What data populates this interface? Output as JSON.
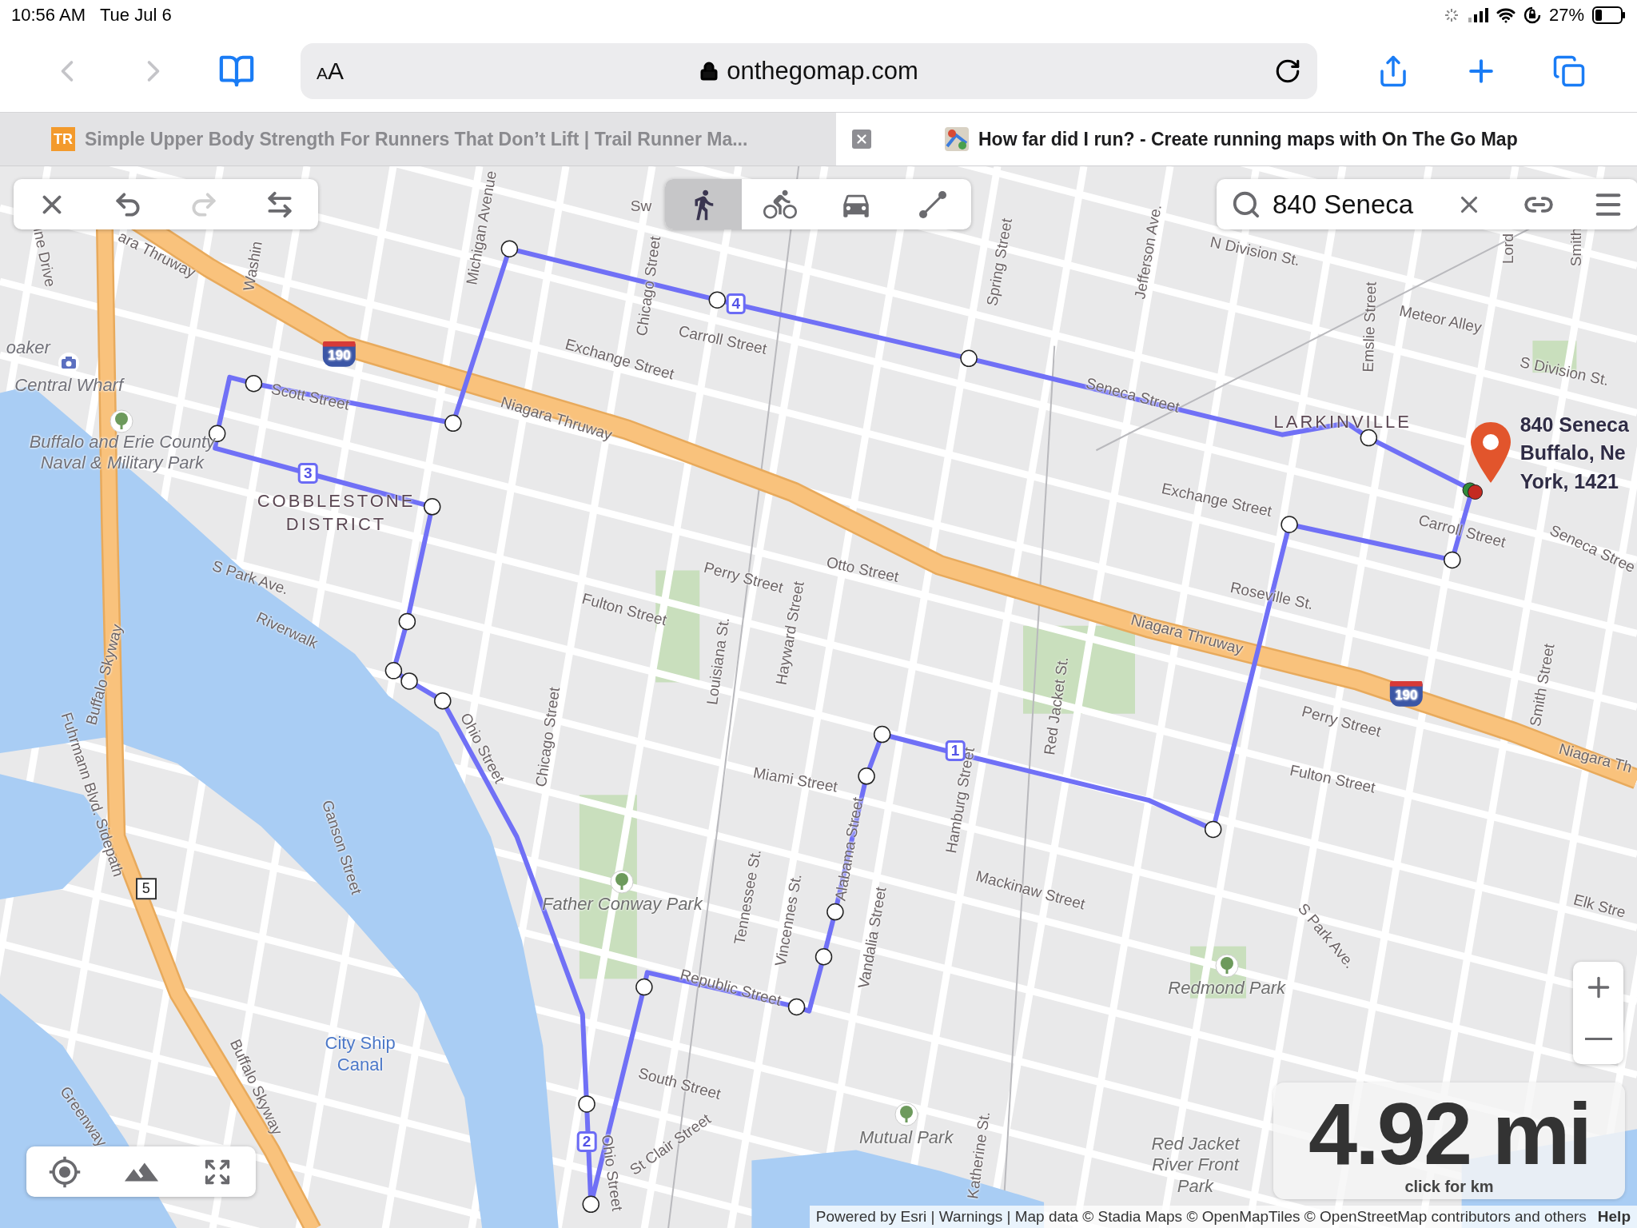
{
  "status_bar": {
    "time": "10:56 AM",
    "date": "Tue Jul 6",
    "battery": "27%"
  },
  "toolbar": {
    "nav": [
      {
        "kind": "back",
        "disabled": true
      },
      {
        "kind": "forward",
        "disabled": true
      }
    ],
    "text_size": "AA",
    "url": "onthegomap.com"
  },
  "tabs": [
    {
      "favicon": "TR",
      "title": "Simple Upper Body Strength For Runners That Don’t Lift | Trail Runner Ma...",
      "selected": false
    },
    {
      "title": "How far did I run? - Create running maps with On The Go Map",
      "selected": true
    }
  ],
  "map": {
    "edit_tools": [
      {
        "kind": "clear",
        "disabled": false
      },
      {
        "kind": "undo",
        "disabled": false
      },
      {
        "kind": "redo",
        "disabled": true
      },
      {
        "kind": "reverse",
        "disabled": false
      }
    ],
    "modes": [
      {
        "kind": "walk",
        "selected": true
      },
      {
        "kind": "bike",
        "selected": false
      },
      {
        "kind": "car",
        "selected": false
      },
      {
        "kind": "line",
        "selected": false
      }
    ],
    "search": {
      "value": "840 Seneca"
    },
    "labels": [
      {
        "kind": "street",
        "text": "ara Thruway"
      },
      {
        "kind": "street",
        "text": "ine Drive"
      },
      {
        "kind": "street",
        "text": "Washin"
      },
      {
        "kind": "street",
        "text": "Michigan Avenue"
      },
      {
        "kind": "street",
        "text": "Sw"
      },
      {
        "kind": "street",
        "text": "Chicago Street"
      },
      {
        "kind": "street",
        "text": "Carroll Street"
      },
      {
        "kind": "street",
        "text": "Exchange Street"
      },
      {
        "kind": "street",
        "text": "Scott Street"
      },
      {
        "kind": "street",
        "text": "Niagara Thruway"
      },
      {
        "kind": "poi",
        "text": "oaker"
      },
      {
        "kind": "poi",
        "text": "Central Wharf"
      },
      {
        "kind": "poi",
        "text": "Buffalo and Erie County Naval & Military Park"
      },
      {
        "kind": "district",
        "text": "COBBLESTONE DISTRICT"
      },
      {
        "kind": "street",
        "text": "S Park Ave."
      },
      {
        "kind": "street",
        "text": "Riverwalk"
      },
      {
        "kind": "street",
        "text": "Buffalo Skyway"
      },
      {
        "kind": "street",
        "text": "Fuhrmann Blvd. Sidepath"
      },
      {
        "kind": "street",
        "text": "Ohio Street"
      },
      {
        "kind": "street",
        "text": "Chicago Street"
      },
      {
        "kind": "street",
        "text": "Ganson Street"
      },
      {
        "kind": "street",
        "text": "Louisiana St."
      },
      {
        "kind": "street",
        "text": "Hayward Street"
      },
      {
        "kind": "street",
        "text": "Perry Street"
      },
      {
        "kind": "street",
        "text": "Fulton Street"
      },
      {
        "kind": "street",
        "text": "Otto Street"
      },
      {
        "kind": "street",
        "text": "Miami Street"
      },
      {
        "kind": "park",
        "text": "Father Conway Park"
      },
      {
        "kind": "street",
        "text": "Tennessee St."
      },
      {
        "kind": "street",
        "text": "Vincennes St."
      },
      {
        "kind": "street",
        "text": "Alabama Street"
      },
      {
        "kind": "street",
        "text": "Vandalia Street"
      },
      {
        "kind": "street",
        "text": "Republic Street"
      },
      {
        "kind": "street",
        "text": "Hamburg Street"
      },
      {
        "kind": "street",
        "text": "Red Jacket St."
      },
      {
        "kind": "street",
        "text": "Mackinaw Street"
      },
      {
        "kind": "street",
        "text": "South Street"
      },
      {
        "kind": "street",
        "text": "St Clair Street"
      },
      {
        "kind": "street",
        "text": "Ohio Street"
      },
      {
        "kind": "water",
        "text": "City Ship Canal"
      },
      {
        "kind": "street",
        "text": "Buffalo Skyway"
      },
      {
        "kind": "street",
        "text": "Greenway"
      },
      {
        "kind": "park",
        "text": "Mutual Park"
      },
      {
        "kind": "street",
        "text": "Katherine St."
      },
      {
        "kind": "park",
        "text": "Redmond Park"
      },
      {
        "kind": "park",
        "text": "Red Jacket River Front Park"
      },
      {
        "kind": "street",
        "text": "S Park Ave."
      },
      {
        "kind": "street",
        "text": "Elk Stre"
      },
      {
        "kind": "street",
        "text": "Jefferson Ave."
      },
      {
        "kind": "street",
        "text": "Spring Street"
      },
      {
        "kind": "street",
        "text": "N Division St."
      },
      {
        "kind": "street",
        "text": "Meteor Alley"
      },
      {
        "kind": "street",
        "text": "S Division St."
      },
      {
        "kind": "street",
        "text": "Emslie Street"
      },
      {
        "kind": "street",
        "text": "Lord"
      },
      {
        "kind": "street",
        "text": "Smith"
      },
      {
        "kind": "street",
        "text": "Seneca Street"
      },
      {
        "kind": "district",
        "text": "LARKINVILLE"
      },
      {
        "kind": "street",
        "text": "Exchange Street"
      },
      {
        "kind": "street",
        "text": "Carroll Street"
      },
      {
        "kind": "street",
        "text": "Seneca Stree"
      },
      {
        "kind": "street",
        "text": "Roseville St."
      },
      {
        "kind": "street",
        "text": "Niagara Thruway"
      },
      {
        "kind": "street",
        "text": "Perry Street"
      },
      {
        "kind": "street",
        "text": "Fulton Street"
      },
      {
        "kind": "street",
        "text": "Niagara Th"
      },
      {
        "kind": "street",
        "text": "Smith Street"
      },
      {
        "kind": "interstate",
        "text": "190"
      },
      {
        "kind": "interstate",
        "text": "190"
      },
      {
        "kind": "route",
        "text": "5"
      },
      {
        "kind": "address",
        "text": "840 Seneca"
      },
      {
        "kind": "address",
        "text": "Buffalo, Ne"
      },
      {
        "kind": "address",
        "text": "York, 1421"
      }
    ],
    "route_markers": [
      {
        "label": "1"
      },
      {
        "label": "2"
      },
      {
        "label": "3"
      },
      {
        "label": "4"
      }
    ],
    "distance": {
      "value": "4.92 mi",
      "hint": "click for km"
    },
    "attribution": "Powered by Esri | Warnings | Map data © Stadia Maps © OpenMapTiles © OpenStreetMap contributors and others",
    "help": "Help"
  }
}
